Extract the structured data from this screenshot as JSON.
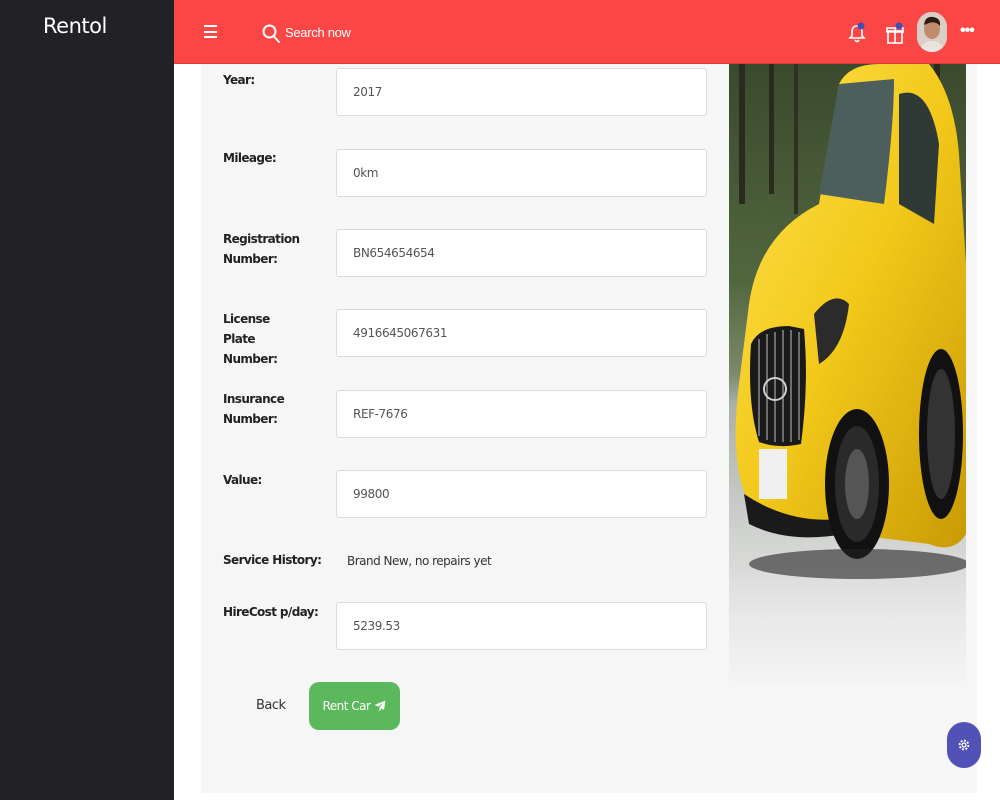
{
  "app": {
    "brand": "Rentol"
  },
  "header": {
    "search_placeholder": "Search now",
    "more_label": "•••"
  },
  "form": {
    "fields": [
      {
        "label": "Year:",
        "value": "2017"
      },
      {
        "label": "Mileage:",
        "value": "0km"
      },
      {
        "label": "Registration Number:",
        "value": "BN654654654"
      },
      {
        "label": "License Plate Number:",
        "value": "4916645067631"
      },
      {
        "label": "Insurance Number:",
        "value": "REF-7676"
      },
      {
        "label": "Value:",
        "value": "99800"
      },
      {
        "label": "HireCost p/day:",
        "value": "5239.53"
      }
    ],
    "service_history": {
      "label": "Service History:",
      "value": "Brand New, no repairs yet"
    },
    "back_label": "Back",
    "rent_label": "Rent Car"
  },
  "colors": {
    "header": "#fb4646",
    "sidebar": "#222226",
    "rent_button": "#5cb85c",
    "settings_fab": "#5251b7",
    "car": "#f2c81a"
  },
  "icons": [
    "menu-icon",
    "search-icon",
    "bell-icon",
    "gift-icon",
    "avatar",
    "more-icon",
    "paper-plane-icon",
    "gear-icon"
  ]
}
